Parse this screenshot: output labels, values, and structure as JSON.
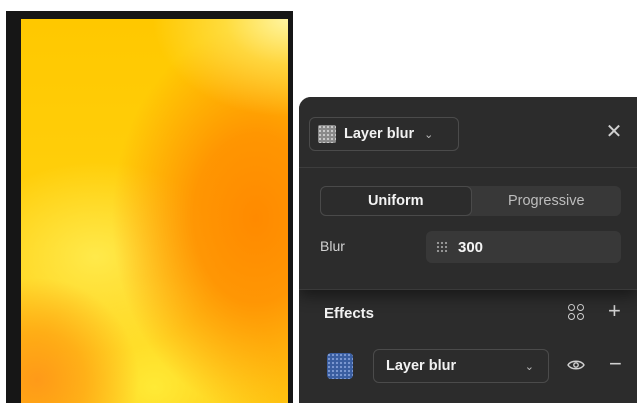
{
  "popup": {
    "effect_type": "Layer blur",
    "close_glyph": "✕",
    "modes": [
      {
        "label": "Uniform",
        "active": true
      },
      {
        "label": "Progressive",
        "active": false
      }
    ],
    "blur_label": "Blur",
    "blur_value": "300"
  },
  "effects": {
    "title": "Effects",
    "add_glyph": "+",
    "item": {
      "label": "Layer blur",
      "remove_glyph": "−"
    }
  },
  "icons": {
    "chevron": "⌄"
  },
  "colors": {
    "panel_bg": "#2c2c2c",
    "canvas_frame": "#161616",
    "swatch_blue": "#3a5ea0"
  }
}
